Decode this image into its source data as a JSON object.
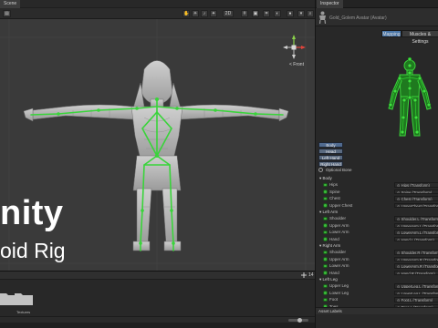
{
  "scene": {
    "tab_label": "Scene",
    "toolbar": {
      "layers_value": "2D",
      "gizmos_label": "Gizmos"
    },
    "view_label": "< Front",
    "overlay_title": "nity",
    "overlay_subtitle": "oid Rig"
  },
  "project": {
    "folders": [
      {
        "label": ""
      },
      {
        "label": "Textures"
      }
    ],
    "footer_value": "14"
  },
  "inspector": {
    "tab_label": "Inspector",
    "object_name": "Gold_Golem Avatar (Avatar)",
    "tabs": [
      "Mapping",
      "Muscles & Settings"
    ],
    "active_tab": 0,
    "body_parts": [
      "Body",
      "Head",
      "Left Hand",
      "Right Hand"
    ],
    "optional_bone_label": "Optional Bone",
    "asset_labels": "Asset Labels",
    "groups": [
      {
        "name": "Body",
        "bones": [
          {
            "name": "Hips",
            "field": "Hips (Transform)"
          },
          {
            "name": "Spine",
            "field": "Spine (Transform)"
          },
          {
            "name": "Chest",
            "field": "Chest (Transform)"
          },
          {
            "name": "Upper Chest",
            "field": "UpperChest (Transform)"
          }
        ]
      },
      {
        "name": "Left Arm",
        "bones": [
          {
            "name": "Shoulder",
            "field": "Shoulder.L (Transform)"
          },
          {
            "name": "Upper Arm",
            "field": "UpperArm.L (Transform)"
          },
          {
            "name": "Lower Arm",
            "field": "LowerArm.L (Transform)"
          },
          {
            "name": "Hand",
            "field": "Hand.L (Transform)"
          }
        ]
      },
      {
        "name": "Right Arm",
        "bones": [
          {
            "name": "Shoulder",
            "field": "Shoulder.R (Transform)"
          },
          {
            "name": "Upper Arm",
            "field": "UpperArm.R (Transform)"
          },
          {
            "name": "Lower Arm",
            "field": "LowerArm.R (Transform)"
          },
          {
            "name": "Hand",
            "field": "Hand.R (Transform)"
          }
        ]
      },
      {
        "name": "Left Leg",
        "bones": [
          {
            "name": "Upper Leg",
            "field": "UpperLeg.L (Transform)"
          },
          {
            "name": "Lower Leg",
            "field": "LowerLeg.L (Transform)"
          },
          {
            "name": "Foot",
            "field": "Foot.L (Transform)"
          },
          {
            "name": "Toes",
            "field": "Toes.L (Transform)"
          }
        ]
      }
    ]
  },
  "colors": {
    "bone_green": "#39d43a",
    "mapping_active": "#4a76a8",
    "panel_bg": "#282828",
    "scene_bg": "#3a3a3a"
  }
}
